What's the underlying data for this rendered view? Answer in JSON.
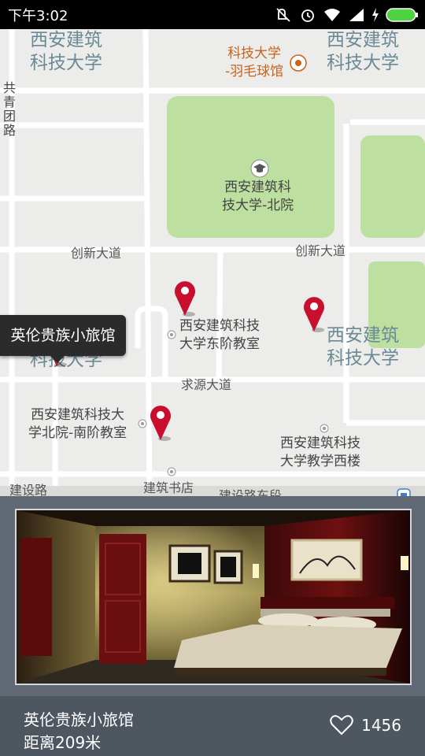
{
  "statusbar": {
    "time": "下午3:02"
  },
  "map": {
    "labels": {
      "campus_tl": "西安建筑\n科技大学",
      "campus_tr": "西安建筑\n科技大学",
      "badminton": "科技大学\n-羽毛球馆",
      "road_left": "共\n青\n团\n路",
      "north_campus": "西安建筑科\n技大学-北院",
      "chuangxin_1": "创新大道",
      "chuangxin_2": "创新大道",
      "east_building": "西安建筑科技\n大学东阶教室",
      "campus_mr": "西安建筑\n科技大学",
      "campus_ml": "西安建筑\n科技大学",
      "qiuyuan": "求源大道",
      "south_building": "西安建筑科技大\n学北院-南阶教室",
      "west_building": "西安建筑科技\n大学教学西楼",
      "jianshe": "建设路",
      "bookstore": "建筑书店",
      "jianshe_east": "建设路东段"
    },
    "tooltip": "英伦贵族小旅馆",
    "pin_color": "#c8102e",
    "park_color": "#bde0a0"
  },
  "hotel": {
    "name": "英伦贵族小旅馆",
    "distance": "距离209米",
    "likes": "1456"
  }
}
